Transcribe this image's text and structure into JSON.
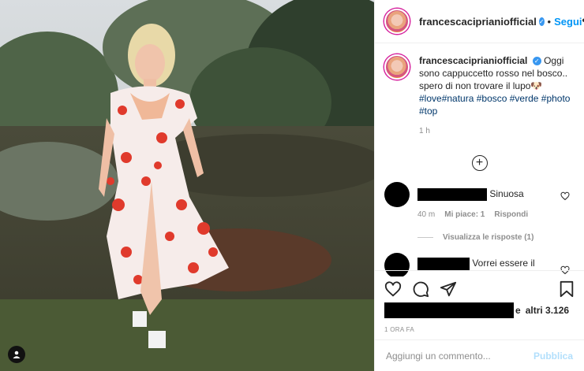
{
  "post": {
    "username": "francescacipri­aniofficial",
    "follow_label": "Segui",
    "separator": "•",
    "more": "•••",
    "caption_user": "francescaciprianiofficial",
    "caption_text": "Oggi sono cappuccetto rosso nel bosco.. spero di non trovare il lupo🐶",
    "hashtags": "#love#natura #bosco #verde #photo #top",
    "caption_time": "1 h",
    "load_more": "+"
  },
  "comments": [
    {
      "text": "Sinuosa",
      "age": "40 m",
      "likes": "Mi piace: 1",
      "reply": "Rispondi"
    },
    {
      "text": "Vorrei essere il"
    }
  ],
  "view_replies": "Visualizza le risposte (1)",
  "likes": {
    "suffix": "e",
    "others": "altri 3.126"
  },
  "posted_ago": "1 ORA FA",
  "comment_box": {
    "placeholder": "Aggiungi un commento...",
    "publish": "Pubblica"
  },
  "icons": [
    "heart-icon",
    "comment-icon",
    "share-icon",
    "bookmark-icon",
    "person-tag-icon",
    "verified-badge-icon"
  ],
  "colors": {
    "link": "#0095f6",
    "hashtag": "#00376b",
    "muted": "#8e8e8e",
    "verified": "#3897f0"
  }
}
